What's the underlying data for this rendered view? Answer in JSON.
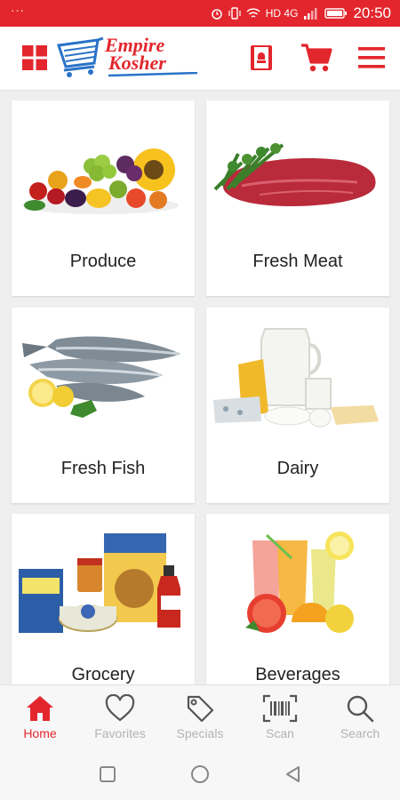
{
  "status_bar": {
    "dots": "···",
    "network": "HD 4G",
    "time": "20:50"
  },
  "header": {
    "brand_line1": "Empire",
    "brand_line2": "Kosher"
  },
  "categories": [
    {
      "label": "Produce"
    },
    {
      "label": "Fresh Meat"
    },
    {
      "label": "Fresh Fish"
    },
    {
      "label": "Dairy"
    },
    {
      "label": "Grocery"
    },
    {
      "label": "Beverages"
    }
  ],
  "bottom_nav": {
    "active": "Home",
    "items": [
      {
        "label": "Home",
        "icon": "home-icon"
      },
      {
        "label": "Favorites",
        "icon": "heart-icon"
      },
      {
        "label": "Specials",
        "icon": "tag-icon"
      },
      {
        "label": "Scan",
        "icon": "barcode-icon"
      },
      {
        "label": "Search",
        "icon": "search-icon"
      }
    ]
  },
  "colors": {
    "brand": "#e3262d",
    "inactive": "#b3b3b3"
  }
}
